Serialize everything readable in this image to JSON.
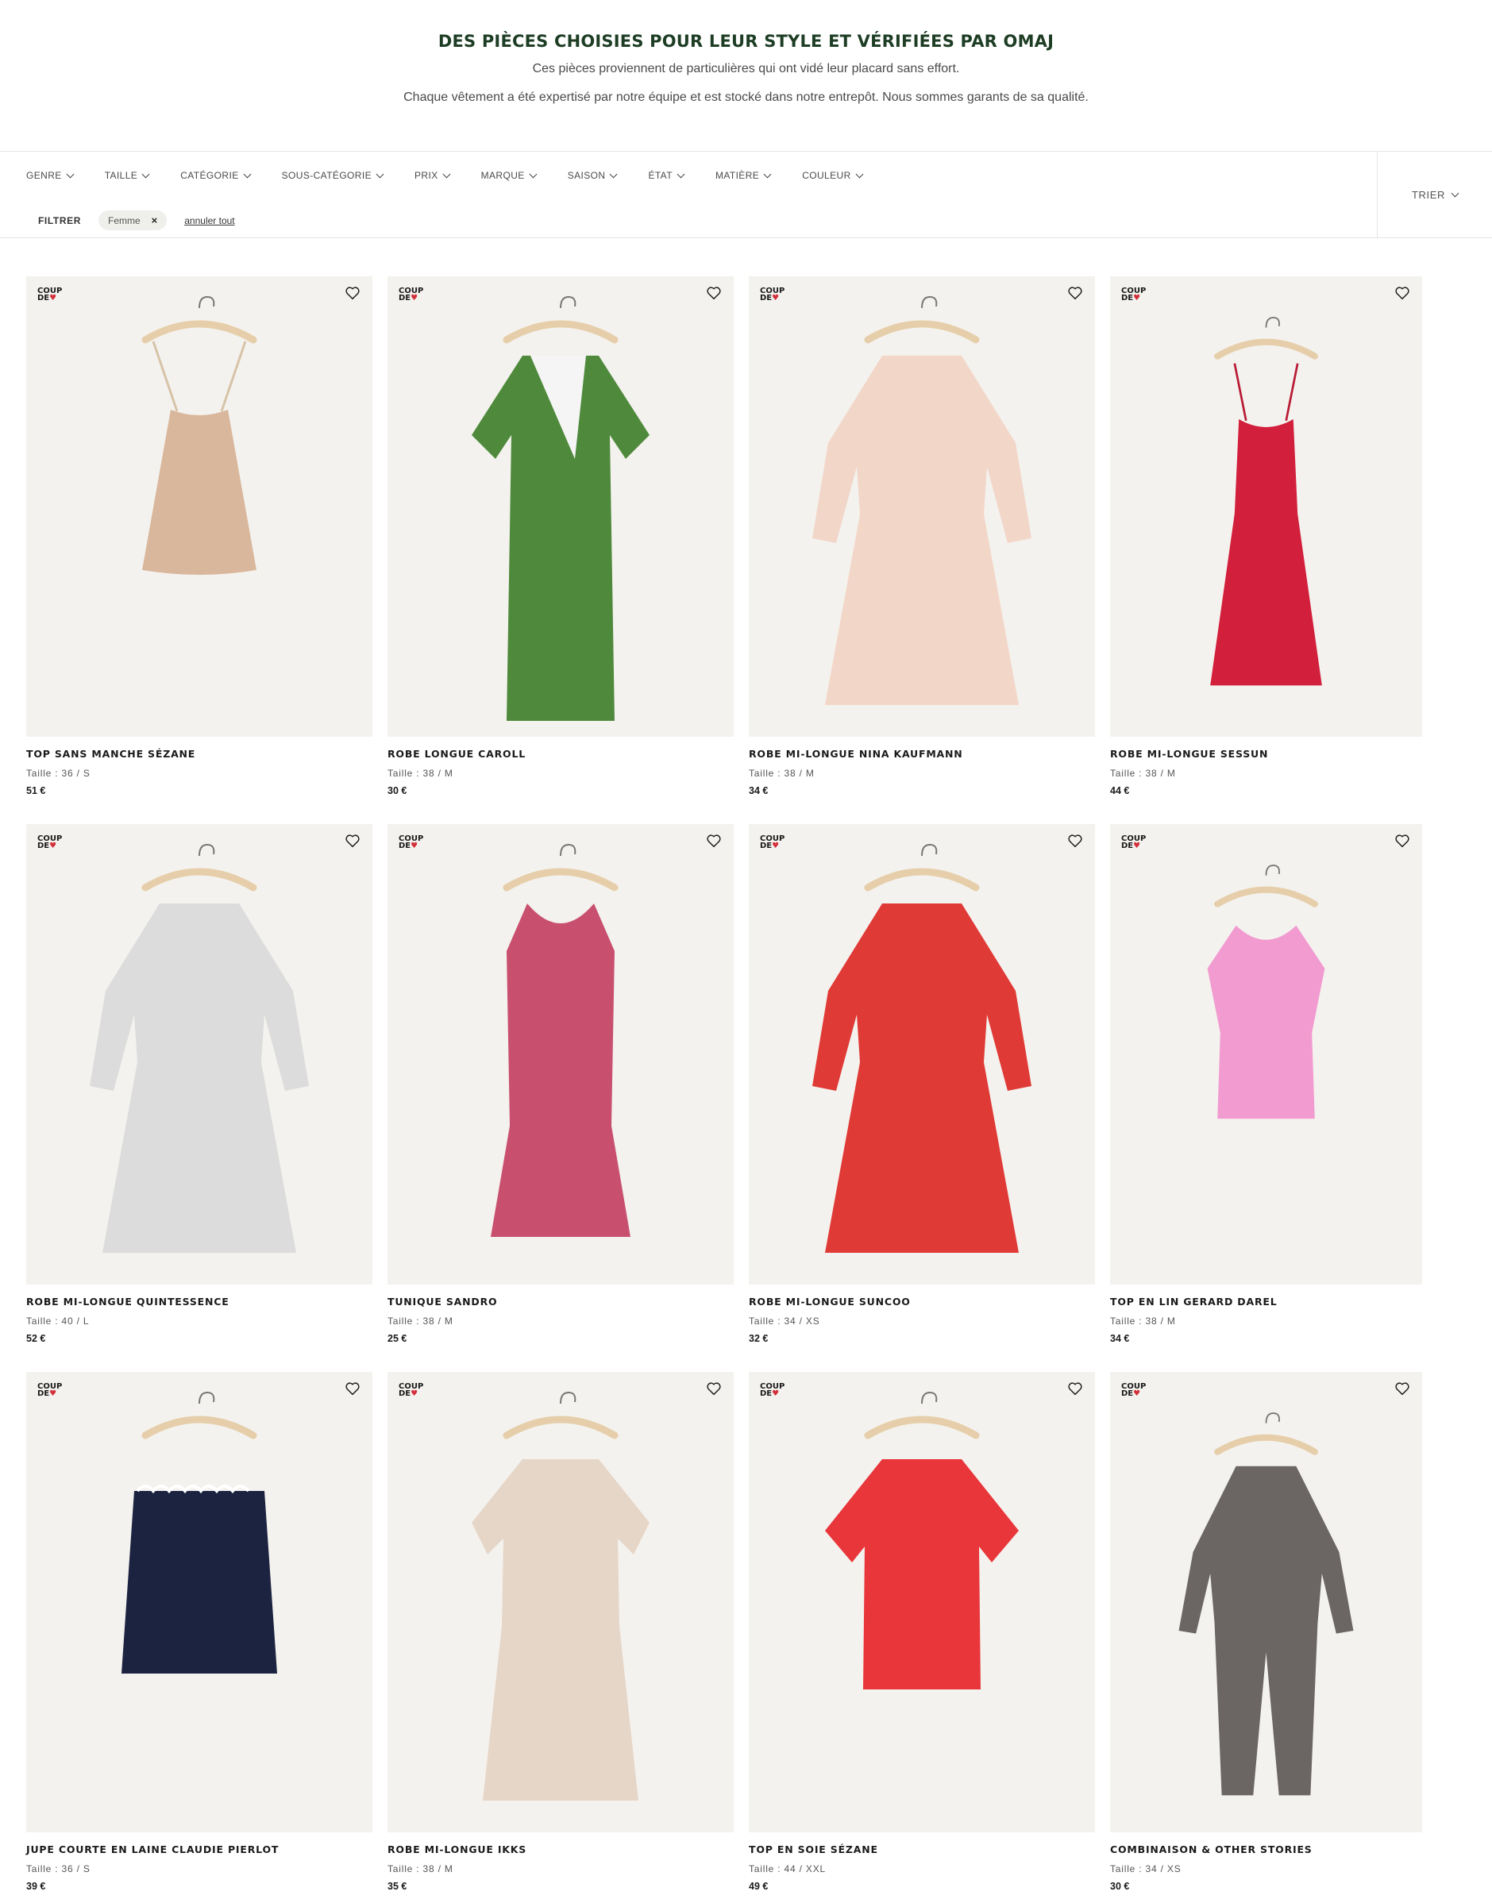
{
  "hero": {
    "title": "DES PIÈCES CHOISIES POUR LEUR STYLE ET VÉRIFIÉES PAR OMAJ",
    "line1": "Ces pièces proviennent de particulières qui ont vidé leur placard sans effort.",
    "line2": "Chaque vêtement a été expertisé par notre équipe et est stocké dans notre entrepôt. Nous sommes garants de sa qualité."
  },
  "filters": [
    "GENRE",
    "TAILLE",
    "CATÉGORIE",
    "SOUS-CATÉGORIE",
    "PRIX",
    "MARQUE",
    "SAISON",
    "ÉTAT",
    "MATIÈRE",
    "COULEUR"
  ],
  "active_filters": {
    "label": "FILTRER",
    "chip": "Femme",
    "chip_remove": "×",
    "clear_all": "annuler tout"
  },
  "sort": {
    "label": "TRIER"
  },
  "badge": {
    "line1": "COUP",
    "line2": "DE"
  },
  "colors": {
    "brand_green": "#1d3d24",
    "photo_bg": "#f4f2ee",
    "heart_red": "#d32f3a"
  },
  "products": [
    {
      "title": "TOP SANS MANCHE SÉZANE",
      "size": "Taille : 36 / S",
      "price": "51 €",
      "garment": "camisole-top",
      "color": "#d9b79c"
    },
    {
      "title": "ROBE LONGUE CAROLL",
      "size": "Taille : 38 / M",
      "price": "30 €",
      "garment": "wrap-dress-long",
      "color": "#4f8a3c"
    },
    {
      "title": "ROBE MI-LONGUE NINA KAUFMANN",
      "size": "Taille : 38 / M",
      "price": "34 €",
      "garment": "long-sleeve-dress",
      "color": "#f2d6c8"
    },
    {
      "title": "ROBE MI-LONGUE SESSUN",
      "size": "Taille : 38 / M",
      "price": "44 €",
      "garment": "slip-dress",
      "color": "#d21f3c"
    },
    {
      "title": "ROBE MI-LONGUE QUINTESSENCE",
      "size": "Taille : 40 / L",
      "price": "52 €",
      "garment": "long-sleeve-dress",
      "color": "#dcdcdc"
    },
    {
      "title": "TUNIQUE SANDRO",
      "size": "Taille : 38 / M",
      "price": "25 €",
      "garment": "tank-dress",
      "color": "#c8506e"
    },
    {
      "title": "ROBE MI-LONGUE SUNCOO",
      "size": "Taille : 34 / XS",
      "price": "32 €",
      "garment": "long-sleeve-dress",
      "color": "#e03a36"
    },
    {
      "title": "TOP EN LIN GERARD DAREL",
      "size": "Taille : 38 / M",
      "price": "34 €",
      "garment": "sleeveless-top",
      "color": "#f19bd0"
    },
    {
      "title": "JUPE COURTE EN LAINE CLAUDIE PIERLOT",
      "size": "Taille : 36 / S",
      "price": "39 €",
      "garment": "skirt",
      "color": "#1b2340"
    },
    {
      "title": "ROBE MI-LONGUE IKKS",
      "size": "Taille : 38 / M",
      "price": "35 €",
      "garment": "short-sleeve-dress",
      "color": "#e6d6c8"
    },
    {
      "title": "TOP EN SOIE SÉZANE",
      "size": "Taille : 44 / XXL",
      "price": "49 €",
      "garment": "tee-top",
      "color": "#e8363a"
    },
    {
      "title": "COMBINAISON & OTHER STORIES",
      "size": "Taille : 34 / XS",
      "price": "30 €",
      "garment": "jumpsuit",
      "color": "#6b6664"
    }
  ]
}
